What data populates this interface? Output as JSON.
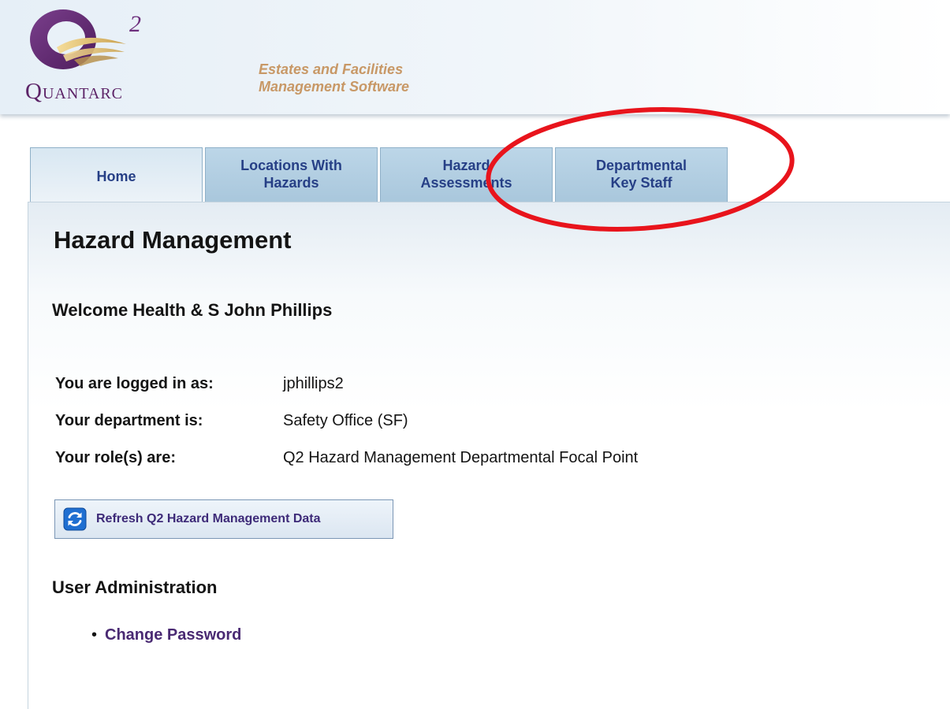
{
  "header": {
    "logo_superscript": "2",
    "logo_wordmark_first": "Q",
    "logo_wordmark_rest": "uantarc",
    "tagline_line1": "Estates and Facilities",
    "tagline_line2": "Management Software"
  },
  "tabs": [
    {
      "line1": "Home",
      "line2": "",
      "active": true
    },
    {
      "line1": "Locations With",
      "line2": "Hazards",
      "active": false
    },
    {
      "line1": "Hazard",
      "line2": "Assessments",
      "active": false
    },
    {
      "line1": "Departmental",
      "line2": "Key Staff",
      "active": false
    }
  ],
  "main": {
    "title": "Hazard Management",
    "welcome": "Welcome Health & S John Phillips",
    "info": [
      {
        "label": "You are logged in as:",
        "value": "jphillips2"
      },
      {
        "label": "Your department is:",
        "value": "Safety Office (SF)"
      },
      {
        "label": "Your role(s) are:",
        "value": "Q2 Hazard Management Departmental Focal Point"
      }
    ],
    "refresh_button": {
      "label": "Refresh Q2 Hazard Management Data",
      "icon": "refresh-icon"
    },
    "admin_section": {
      "title": "User Administration",
      "links": [
        {
          "label": "Change Password"
        }
      ]
    }
  },
  "colors": {
    "tab_text": "#263f86",
    "tagline": "#c89866",
    "logo_purple": "#5c2367",
    "link": "#4a2a73",
    "annotation": "#e8141c"
  }
}
